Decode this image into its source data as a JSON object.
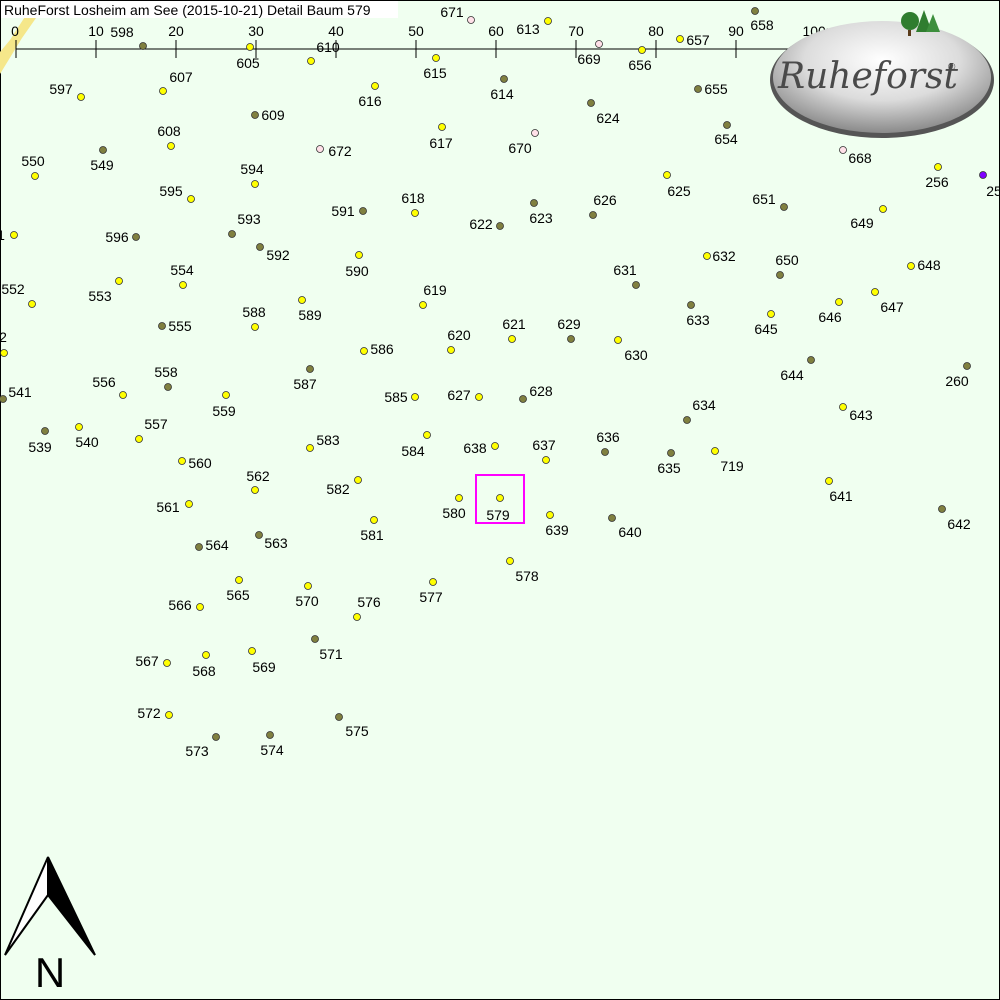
{
  "title": "RuheForst Losheim am See (2015-10-21) Detail  Baum 579",
  "north_label": "N",
  "logo_text": "Ruheforst",
  "logo_reg": "®",
  "selected_tree": "579",
  "colors": {
    "background": "#f0fff0",
    "yellow": "#ffff00",
    "olive": "#808040",
    "pink": "#ffe0e8",
    "violet": "#8000ff",
    "highlight": "#ff00ff"
  },
  "scale": {
    "ticks": [
      "0",
      "10",
      "20",
      "30",
      "40",
      "50",
      "60",
      "70",
      "80",
      "90",
      "100m"
    ]
  },
  "trees": [
    {
      "id": "671",
      "c": "pink"
    },
    {
      "id": "613",
      "c": "yellow"
    },
    {
      "id": "658",
      "c": "olive"
    },
    {
      "id": "598",
      "c": "olive"
    },
    {
      "id": "610",
      "c": "yellow"
    },
    {
      "id": "605",
      "c": "yellow"
    },
    {
      "id": "669",
      "c": "pink"
    },
    {
      "id": "656",
      "c": "yellow"
    },
    {
      "id": "657",
      "c": "yellow"
    },
    {
      "id": "615",
      "c": "yellow"
    },
    {
      "id": "597",
      "c": "yellow"
    },
    {
      "id": "607",
      "c": "yellow"
    },
    {
      "id": "616",
      "c": "yellow"
    },
    {
      "id": "614",
      "c": "olive"
    },
    {
      "id": "655",
      "c": "olive"
    },
    {
      "id": "609",
      "c": "olive"
    },
    {
      "id": "624",
      "c": "olive"
    },
    {
      "id": "608",
      "c": "yellow"
    },
    {
      "id": "617",
      "c": "yellow"
    },
    {
      "id": "654",
      "c": "olive"
    },
    {
      "id": "670",
      "c": "pink"
    },
    {
      "id": "672",
      "c": "pink"
    },
    {
      "id": "549",
      "c": "olive"
    },
    {
      "id": "550",
      "c": "yellow"
    },
    {
      "id": "668",
      "c": "pink"
    },
    {
      "id": "594",
      "c": "yellow"
    },
    {
      "id": "595",
      "c": "yellow"
    },
    {
      "id": "625",
      "c": "yellow"
    },
    {
      "id": "256",
      "c": "yellow"
    },
    {
      "id": "25",
      "c": "violet"
    },
    {
      "id": "618",
      "c": "yellow"
    },
    {
      "id": "591",
      "c": "olive"
    },
    {
      "id": "626",
      "c": "olive"
    },
    {
      "id": "651",
      "c": "olive"
    },
    {
      "id": "623",
      "c": "olive"
    },
    {
      "id": "622",
      "c": "olive"
    },
    {
      "id": "649",
      "c": "yellow"
    },
    {
      "id": "1",
      "c": "yellow"
    },
    {
      "id": "596",
      "c": "olive"
    },
    {
      "id": "593",
      "c": "olive"
    },
    {
      "id": "592",
      "c": "olive"
    },
    {
      "id": "590",
      "c": "yellow"
    },
    {
      "id": "632",
      "c": "yellow"
    },
    {
      "id": "650",
      "c": "olive"
    },
    {
      "id": "648",
      "c": "yellow"
    },
    {
      "id": "554",
      "c": "yellow"
    },
    {
      "id": "631",
      "c": "olive"
    },
    {
      "id": "552",
      "c": "yellow"
    },
    {
      "id": "553",
      "c": "yellow"
    },
    {
      "id": "619",
      "c": "yellow"
    },
    {
      "id": "647",
      "c": "yellow"
    },
    {
      "id": "646",
      "c": "yellow"
    },
    {
      "id": "633",
      "c": "olive"
    },
    {
      "id": "588",
      "c": "yellow"
    },
    {
      "id": "589",
      "c": "yellow"
    },
    {
      "id": "645",
      "c": "yellow"
    },
    {
      "id": "555",
      "c": "olive"
    },
    {
      "id": "621",
      "c": "yellow"
    },
    {
      "id": "629",
      "c": "olive"
    },
    {
      "id": "620",
      "c": "yellow"
    },
    {
      "id": "2",
      "c": "yellow"
    },
    {
      "id": "586",
      "c": "yellow"
    },
    {
      "id": "630",
      "c": "yellow"
    },
    {
      "id": "644",
      "c": "olive"
    },
    {
      "id": "260",
      "c": "olive"
    },
    {
      "id": "587",
      "c": "olive"
    },
    {
      "id": "558",
      "c": "olive"
    },
    {
      "id": "556",
      "c": "yellow"
    },
    {
      "id": "541",
      "c": "olive"
    },
    {
      "id": "628",
      "c": "olive"
    },
    {
      "id": "627",
      "c": "yellow"
    },
    {
      "id": "585",
      "c": "yellow"
    },
    {
      "id": "559",
      "c": "yellow"
    },
    {
      "id": "634",
      "c": "olive"
    },
    {
      "id": "643",
      "c": "yellow"
    },
    {
      "id": "539",
      "c": "olive"
    },
    {
      "id": "540",
      "c": "yellow"
    },
    {
      "id": "557",
      "c": "yellow"
    },
    {
      "id": "636",
      "c": "olive"
    },
    {
      "id": "583",
      "c": "yellow"
    },
    {
      "id": "637",
      "c": "yellow"
    },
    {
      "id": "638",
      "c": "yellow"
    },
    {
      "id": "584",
      "c": "yellow"
    },
    {
      "id": "719",
      "c": "yellow"
    },
    {
      "id": "635",
      "c": "olive"
    },
    {
      "id": "560",
      "c": "yellow"
    },
    {
      "id": "562",
      "c": "yellow"
    },
    {
      "id": "582",
      "c": "yellow"
    },
    {
      "id": "641",
      "c": "yellow"
    },
    {
      "id": "580",
      "c": "yellow"
    },
    {
      "id": "579",
      "c": "yellow"
    },
    {
      "id": "561",
      "c": "yellow"
    },
    {
      "id": "642",
      "c": "olive"
    },
    {
      "id": "639",
      "c": "yellow"
    },
    {
      "id": "640",
      "c": "olive"
    },
    {
      "id": "581",
      "c": "yellow"
    },
    {
      "id": "564",
      "c": "olive"
    },
    {
      "id": "563",
      "c": "olive"
    },
    {
      "id": "578",
      "c": "yellow"
    },
    {
      "id": "565",
      "c": "yellow"
    },
    {
      "id": "577",
      "c": "yellow"
    },
    {
      "id": "570",
      "c": "yellow"
    },
    {
      "id": "576",
      "c": "yellow"
    },
    {
      "id": "566",
      "c": "yellow"
    },
    {
      "id": "571",
      "c": "olive"
    },
    {
      "id": "567",
      "c": "yellow"
    },
    {
      "id": "569",
      "c": "yellow"
    },
    {
      "id": "568",
      "c": "yellow"
    },
    {
      "id": "572",
      "c": "yellow"
    },
    {
      "id": "575",
      "c": "olive"
    },
    {
      "id": "573",
      "c": "olive"
    },
    {
      "id": "574",
      "c": "olive"
    }
  ]
}
